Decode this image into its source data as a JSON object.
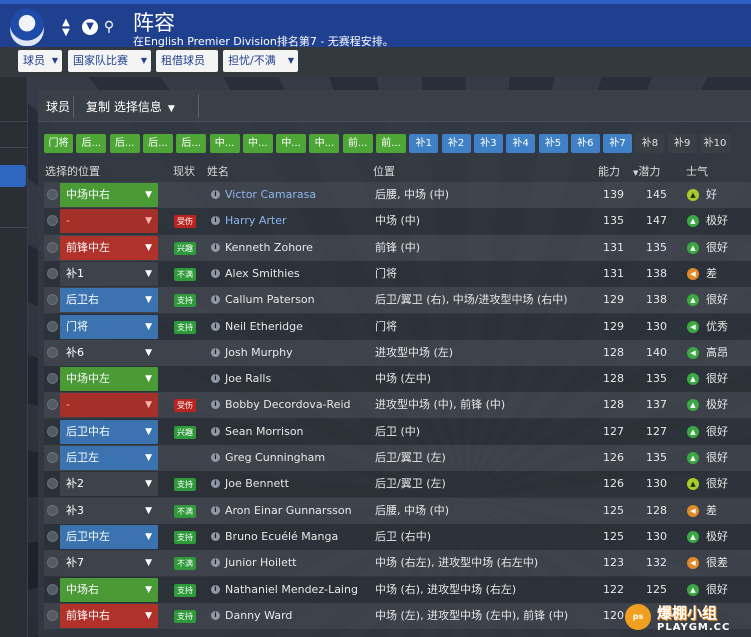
{
  "header": {
    "title": "阵容",
    "subtitle": "在English Premier Division排名第7 - 无赛程安排。"
  },
  "menu": {
    "players": "球员",
    "national": "国家队比赛",
    "loan": "租借球员",
    "tackle": "担忧/不满"
  },
  "toolbar": {
    "players_tab": "球员",
    "copy": "复制 选择信息"
  },
  "position_buttons": [
    {
      "label": "门将",
      "style": "green"
    },
    {
      "label": "后...",
      "style": "green"
    },
    {
      "label": "后...",
      "style": "green"
    },
    {
      "label": "后...",
      "style": "green"
    },
    {
      "label": "后...",
      "style": "green"
    },
    {
      "label": "中...",
      "style": "green"
    },
    {
      "label": "中...",
      "style": "green"
    },
    {
      "label": "中...",
      "style": "green"
    },
    {
      "label": "中...",
      "style": "green"
    },
    {
      "label": "前...",
      "style": "green"
    },
    {
      "label": "前...",
      "style": "green"
    },
    {
      "label": "补1",
      "style": "blue"
    },
    {
      "label": "补2",
      "style": "blue"
    },
    {
      "label": "补3",
      "style": "blue"
    },
    {
      "label": "补4",
      "style": "blue"
    },
    {
      "label": "补5",
      "style": "blue"
    },
    {
      "label": "补6",
      "style": "blue"
    },
    {
      "label": "补7",
      "style": "blue"
    },
    {
      "label": "补8",
      "style": "dark"
    },
    {
      "label": "补9",
      "style": "dark"
    },
    {
      "label": "补10",
      "style": "dark"
    }
  ],
  "columns": {
    "selected_pos": "选择的位置",
    "status": "现状",
    "name": "姓名",
    "position": "位置",
    "ability": "能力",
    "potential": "潜力",
    "morale": "士气"
  },
  "players": [
    {
      "sel": "中场中右",
      "sel_style": "green",
      "status": "",
      "status_style": "",
      "name": "Victor Camarasa",
      "link": true,
      "pos": "后腰, 中场 (中)",
      "ca": "139",
      "pa": "145",
      "morale": "好",
      "m_style": "yg",
      "m_icon": "▲"
    },
    {
      "sel": "-",
      "sel_style": "redd",
      "status": "受伤",
      "status_style": "red",
      "name": "Harry Arter",
      "link": true,
      "pos": "中场 (中)",
      "ca": "135",
      "pa": "147",
      "morale": "极好",
      "m_style": "g",
      "m_icon": "▲"
    },
    {
      "sel": "前锋中左",
      "sel_style": "red",
      "status": "兴趣",
      "status_style": "green",
      "name": "Kenneth Zohore",
      "link": false,
      "pos": "前锋 (中)",
      "ca": "131",
      "pa": "135",
      "morale": "很好",
      "m_style": "g",
      "m_icon": "▲"
    },
    {
      "sel": "补1",
      "sel_style": "dark",
      "status": "不满",
      "status_style": "green",
      "name": "Alex Smithies",
      "link": false,
      "pos": "门将",
      "ca": "131",
      "pa": "138",
      "morale": "差",
      "m_style": "o",
      "m_icon": "◀"
    },
    {
      "sel": "后卫右",
      "sel_style": "blue",
      "status": "支持",
      "status_style": "green",
      "name": "Callum Paterson",
      "link": false,
      "pos": "后卫/翼卫 (右), 中场/进攻型中场 (右中)",
      "ca": "129",
      "pa": "138",
      "morale": "很好",
      "m_style": "g",
      "m_icon": "▲"
    },
    {
      "sel": "门将",
      "sel_style": "blue",
      "status": "支持",
      "status_style": "green",
      "name": "Neil Etheridge",
      "link": false,
      "pos": "门将",
      "ca": "129",
      "pa": "130",
      "morale": "优秀",
      "m_style": "g",
      "m_icon": "◀"
    },
    {
      "sel": "补6",
      "sel_style": "dark",
      "status": "",
      "status_style": "",
      "name": "Josh Murphy",
      "link": false,
      "pos": "进攻型中场 (左)",
      "ca": "128",
      "pa": "140",
      "morale": "高昂",
      "m_style": "g",
      "m_icon": "◀"
    },
    {
      "sel": "中场中左",
      "sel_style": "green",
      "status": "",
      "status_style": "",
      "name": "Joe Ralls",
      "link": false,
      "pos": "中场 (左中)",
      "ca": "128",
      "pa": "135",
      "morale": "很好",
      "m_style": "g",
      "m_icon": "▲"
    },
    {
      "sel": "-",
      "sel_style": "redd",
      "status": "受伤",
      "status_style": "red",
      "name": "Bobby Decordova-Reid",
      "link": false,
      "pos": "进攻型中场 (中), 前锋 (中)",
      "ca": "128",
      "pa": "137",
      "morale": "极好",
      "m_style": "g",
      "m_icon": "▲"
    },
    {
      "sel": "后卫中右",
      "sel_style": "blue",
      "status": "兴趣",
      "status_style": "green",
      "name": "Sean Morrison",
      "link": false,
      "pos": "后卫 (中)",
      "ca": "127",
      "pa": "127",
      "morale": "很好",
      "m_style": "g",
      "m_icon": "▲"
    },
    {
      "sel": "后卫左",
      "sel_style": "blue",
      "status": "",
      "status_style": "",
      "name": "Greg Cunningham",
      "link": false,
      "pos": "后卫/翼卫 (左)",
      "ca": "126",
      "pa": "135",
      "morale": "很好",
      "m_style": "g",
      "m_icon": "▲"
    },
    {
      "sel": "补2",
      "sel_style": "dark",
      "status": "支持",
      "status_style": "green",
      "name": "Joe Bennett",
      "link": false,
      "pos": "后卫/翼卫 (左)",
      "ca": "126",
      "pa": "130",
      "morale": "很好",
      "m_style": "yg",
      "m_icon": "▲"
    },
    {
      "sel": "补3",
      "sel_style": "dark",
      "status": "不满",
      "status_style": "green",
      "name": "Aron Einar Gunnarsson",
      "link": false,
      "pos": "后腰, 中场 (中)",
      "ca": "125",
      "pa": "128",
      "morale": "差",
      "m_style": "o",
      "m_icon": "◀"
    },
    {
      "sel": "后卫中左",
      "sel_style": "blue",
      "status": "支持",
      "status_style": "green",
      "name": "Bruno Ecuélé Manga",
      "link": false,
      "pos": "后卫 (右中)",
      "ca": "125",
      "pa": "130",
      "morale": "极好",
      "m_style": "g",
      "m_icon": "▲"
    },
    {
      "sel": "补7",
      "sel_style": "dark",
      "status": "不满",
      "status_style": "green",
      "name": "Junior Hoilett",
      "link": false,
      "pos": "中场 (右左), 进攻型中场 (右左中)",
      "ca": "123",
      "pa": "132",
      "morale": "很差",
      "m_style": "o",
      "m_icon": "◀"
    },
    {
      "sel": "中场右",
      "sel_style": "green",
      "status": "支持",
      "status_style": "green",
      "name": "Nathaniel Mendez-Laing",
      "link": false,
      "pos": "中场 (右), 进攻型中场 (右左)",
      "ca": "122",
      "pa": "125",
      "morale": "很好",
      "m_style": "g",
      "m_icon": "▲"
    },
    {
      "sel": "前锋中右",
      "sel_style": "red",
      "status": "支持",
      "status_style": "green",
      "name": "Danny Ward",
      "link": false,
      "pos": "中场 (左), 进攻型中场 (左中), 前锋 (中)",
      "ca": "120",
      "pa": "",
      "morale": "",
      "m_style": "",
      "m_icon": ""
    }
  ],
  "watermark": {
    "top": "爆棚小组",
    "bottom": "PLAYGM.CC",
    "icon": "ps"
  }
}
